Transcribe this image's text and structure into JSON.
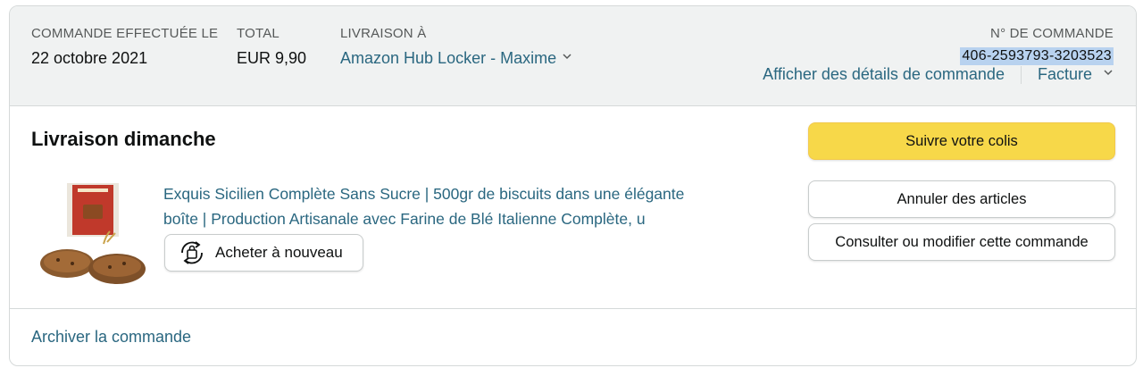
{
  "header": {
    "order_date_label": "COMMANDE EFFECTUÉE LE",
    "order_date": "22 octobre 2021",
    "total_label": "TOTAL",
    "total": "EUR 9,90",
    "ship_to_label": "LIVRAISON À",
    "ship_to": "Amazon Hub Locker - Maxime",
    "order_number_label": "N° DE COMMANDE",
    "order_number": "406-2593793-3203523",
    "details_link": "Afficher des détails de commande",
    "invoice_link": "Facture"
  },
  "shipment": {
    "title": "Livraison dimanche",
    "product": {
      "title_line1": "Exquis Sicilien Complète Sans Sucre | 500gr de biscuits dans une élégante",
      "title_line2": "boîte | Production Artisanale avec Farine de Blé Italienne Complète, u",
      "buy_again_label": "Acheter à nouveau"
    },
    "actions": {
      "track": "Suivre votre colis",
      "cancel": "Annuler des articles",
      "manage": "Consulter ou modifier cette commande"
    }
  },
  "footer": {
    "archive_link": "Archiver la commande"
  },
  "colors": {
    "header_bg": "#f0f2f2",
    "link": "#2a6780",
    "primary_button": "#f7d849",
    "order_number_highlight": "#b8d2ef"
  }
}
